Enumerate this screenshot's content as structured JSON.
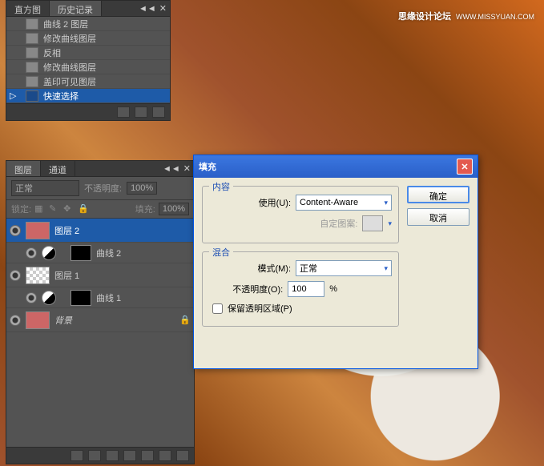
{
  "watermark": {
    "main": "思缘设计论坛",
    "sub": "WWW.MISSYUAN.COM"
  },
  "historyPanel": {
    "tabs": [
      "直方图",
      "历史记录"
    ],
    "activeTab": 1,
    "items": [
      {
        "label": "曲线 2 图层"
      },
      {
        "label": "修改曲线图层"
      },
      {
        "label": "反相"
      },
      {
        "label": "修改曲线图层"
      },
      {
        "label": "盖印可见图层"
      },
      {
        "label": "快速选择",
        "selected": true
      }
    ]
  },
  "layersPanel": {
    "tabs": [
      "图层",
      "通道"
    ],
    "activeTab": 0,
    "blendMode": "正常",
    "opacityLabel": "不透明度:",
    "opacityValue": "100%",
    "lockLabel": "锁定:",
    "fillLabel": "填充:",
    "fillValue": "100%",
    "layers": [
      {
        "name": "图层 2",
        "selected": true,
        "type": "image"
      },
      {
        "name": "曲线 2",
        "type": "adj",
        "sub": true
      },
      {
        "name": "图层 1",
        "type": "checker"
      },
      {
        "name": "曲线 1",
        "type": "adj",
        "sub": true
      },
      {
        "name": "背景",
        "type": "image",
        "locked": true
      }
    ]
  },
  "dialog": {
    "title": "填充",
    "ok": "确定",
    "cancel": "取消",
    "contentGroup": "内容",
    "useLabel": "使用(U):",
    "useValue": "Content-Aware",
    "patternLabel": "自定图案:",
    "blendGroup": "混合",
    "modeLabel": "模式(M):",
    "modeValue": "正常",
    "opacityLabel": "不透明度(O):",
    "opacityValue": "100",
    "opacityUnit": "%",
    "preserveLabel": "保留透明区域(P)"
  }
}
